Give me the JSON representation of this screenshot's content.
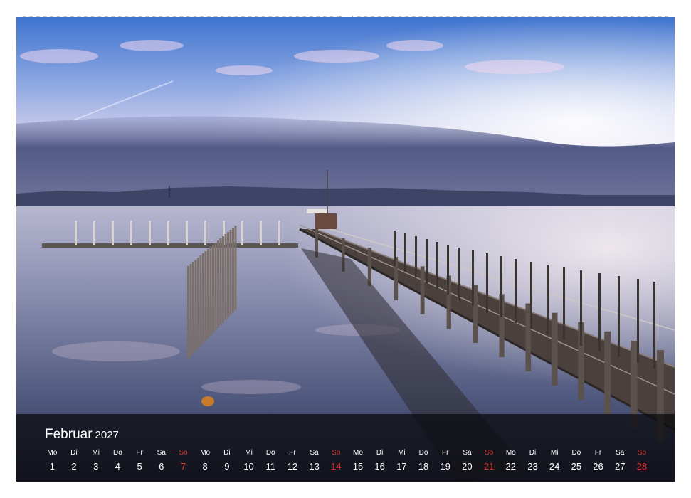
{
  "calendar": {
    "month": "Februar",
    "year": "2027",
    "weekdays": [
      "Mo",
      "Di",
      "Mi",
      "Do",
      "Fr",
      "Sa",
      "So",
      "Mo",
      "Di",
      "Mi",
      "Do",
      "Fr",
      "Sa",
      "So",
      "Mo",
      "Di",
      "Mi",
      "Do",
      "Fr",
      "Sa",
      "So",
      "Mo",
      "Di",
      "Mi",
      "Do",
      "Fr",
      "Sa",
      "So"
    ],
    "days": [
      "1",
      "2",
      "3",
      "4",
      "5",
      "6",
      "7",
      "8",
      "9",
      "10",
      "11",
      "12",
      "13",
      "14",
      "15",
      "16",
      "17",
      "18",
      "19",
      "20",
      "21",
      "22",
      "23",
      "24",
      "25",
      "26",
      "27",
      "28"
    ],
    "sunday_color": "#e0342f",
    "text_color": "#ffffff"
  },
  "photo": {
    "subject": "lake-pier-at-dusk",
    "colors": {
      "sky_top": "#4f7fd0",
      "sky_glow": "#efe6f2",
      "water": "#8f93b3",
      "pier": "#4a403d"
    }
  }
}
